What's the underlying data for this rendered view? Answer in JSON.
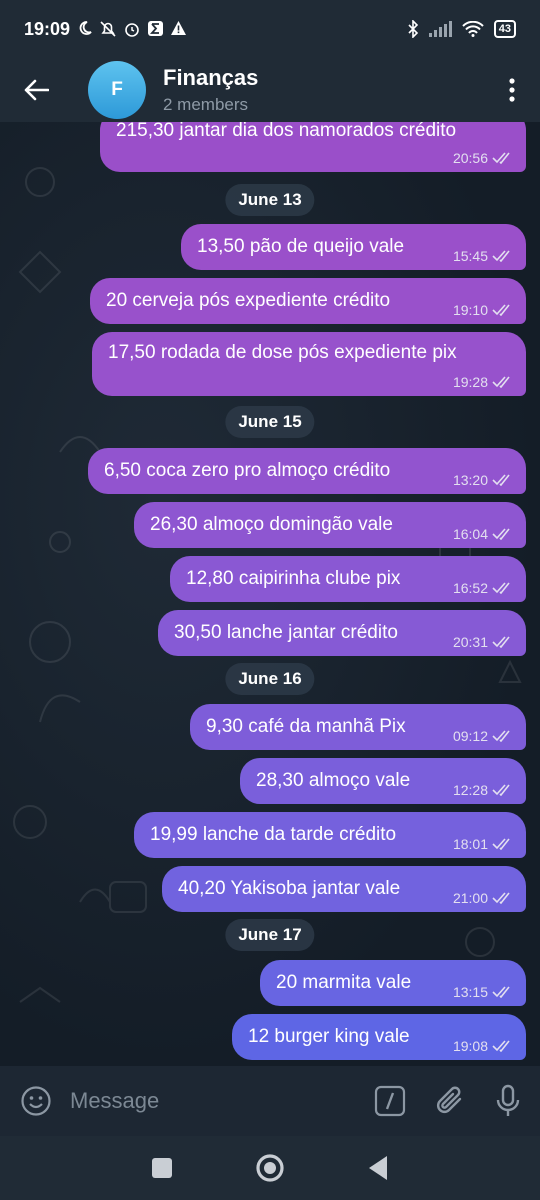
{
  "status": {
    "time": "19:09",
    "battery": "43"
  },
  "header": {
    "avatar_letter": "F",
    "title": "Finanças",
    "subtitle": "2 members"
  },
  "messages": [
    {
      "text": "215,30 jantar dia dos namorados crédito",
      "time": "20:56"
    },
    {
      "text": "13,50 pão de queijo vale",
      "time": "15:45"
    },
    {
      "text": "20 cerveja pós expediente crédito",
      "time": "19:10"
    },
    {
      "text": "17,50 rodada de dose pós expediente pix",
      "time": "19:28"
    },
    {
      "text": "6,50 coca zero pro almoço crédito",
      "time": "13:20"
    },
    {
      "text": "26,30 almoço domingão vale",
      "time": "16:04"
    },
    {
      "text": "12,80 caipirinha clube pix",
      "time": "16:52"
    },
    {
      "text": "30,50 lanche jantar crédito",
      "time": "20:31"
    },
    {
      "text": "9,30 café da manhã Pix",
      "time": "09:12"
    },
    {
      "text": "28,30 almoço vale",
      "time": "12:28"
    },
    {
      "text": "19,99 lanche da tarde crédito",
      "time": "18:01"
    },
    {
      "text": "40,20 Yakisoba jantar vale",
      "time": "21:00"
    },
    {
      "text": "20 marmita vale",
      "time": "13:15"
    },
    {
      "text": "12 burger king vale",
      "time": "19:08"
    }
  ],
  "dates": [
    "June 13",
    "June 15",
    "June 16",
    "June 17"
  ],
  "input": {
    "placeholder": "Message"
  },
  "colors": {
    "bubble_top": "#9a4fc9",
    "bubble_bottom": "#5a63e6",
    "header_bg": "#202b36",
    "avatar": "#3aa9e0"
  }
}
